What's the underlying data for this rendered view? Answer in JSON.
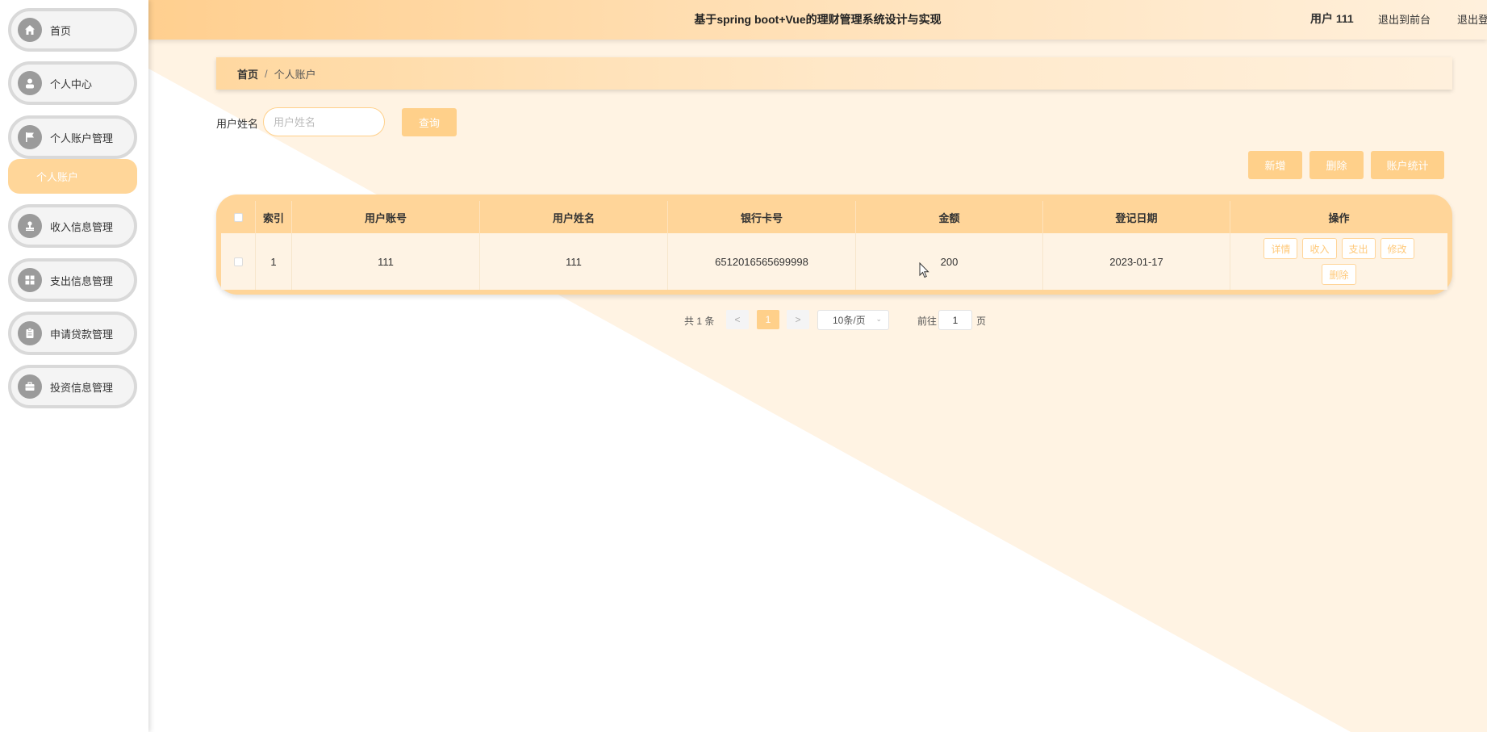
{
  "colors": {
    "accent": "#ffd08a",
    "sidebar_circle": "#9b9b9b",
    "row_bg": "#fef3e4"
  },
  "header": {
    "title": "基于spring boot+Vue的理财管理系统设计与实现",
    "user": "用户 111",
    "back_to_front": "退出到前台",
    "logout": "退出登录"
  },
  "sidebar": {
    "items": [
      {
        "label": "首页",
        "icon": "home-icon"
      },
      {
        "label": "个人中心",
        "icon": "user-icon"
      },
      {
        "label": "个人账户管理",
        "icon": "flag-icon"
      },
      {
        "label": "收入信息管理",
        "icon": "stamp-icon"
      },
      {
        "label": "支出信息管理",
        "icon": "grid-icon"
      },
      {
        "label": "申请贷款管理",
        "icon": "clipboard-icon"
      },
      {
        "label": "投资信息管理",
        "icon": "briefcase-icon"
      }
    ],
    "active_sub": "个人账户"
  },
  "breadcrumb": {
    "home": "首页",
    "separator": "/",
    "current": "个人账户"
  },
  "search": {
    "label": "用户姓名",
    "placeholder": "用户姓名",
    "value": "",
    "button": "查询"
  },
  "toolbar": {
    "add": "新增",
    "delete": "删除",
    "stats": "账户统计"
  },
  "table": {
    "columns": [
      "索引",
      "用户账号",
      "用户姓名",
      "银行卡号",
      "金额",
      "登记日期",
      "操作"
    ],
    "rows": [
      {
        "index": "1",
        "account": "111",
        "name": "111",
        "card": "6512016565699998",
        "amount": "200",
        "date": "2023-01-17"
      }
    ],
    "actions": [
      "详情",
      "收入",
      "支出",
      "修改",
      "删除"
    ]
  },
  "pagination": {
    "total": "共 1 条",
    "prev": "<",
    "current_page": "1",
    "next": ">",
    "page_size": "10条/页",
    "goto_label": "前往",
    "goto_value": "1",
    "page_suffix": "页"
  }
}
